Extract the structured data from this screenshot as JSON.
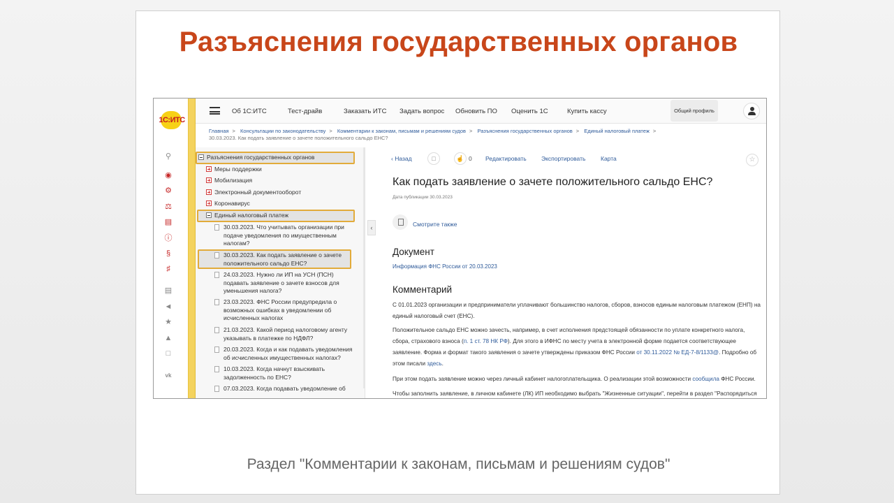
{
  "slide": {
    "title": "Разъяснения государственных органов",
    "caption": "Раздел \"Комментарии к законам, письмам и решениям судов\""
  },
  "app": {
    "logo": "1С:ИТС",
    "nav": [
      "Об 1С:ИТС",
      "Тест-драйв",
      "Заказать ИТС",
      "Задать вопрос",
      "Обновить ПО",
      "Оценить 1С",
      "Купить кассу"
    ],
    "profile_label": "Общий профиль"
  },
  "breadcrumb": {
    "items": [
      "Главная",
      "Консультации по законодательству",
      "Комментарии к законам, письмам и решениям судов",
      "Разъяснения государственных органов",
      "Единый налоговый платеж"
    ],
    "current": "30.03.2023. Как подать заявление о зачете положительного сальдо ЕНС?"
  },
  "tree": {
    "root": "Разъяснения государственных органов",
    "folders": [
      "Меры поддержки",
      "Мобилизация",
      "Электронный документооборот",
      "Коронавирус"
    ],
    "open_folder": "Единый налоговый платеж",
    "docs": [
      "30.03.2023. Что учитывать организации при подаче уведомления по имущественным налогам?",
      "30.03.2023. Как подать заявление о зачете положительного сальдо ЕНС?",
      "24.03.2023. Нужно ли ИП на УСН (ПСН) подавать заявление о зачете взносов для уменьшения налога?",
      "23.03.2023. ФНС России предупредила о возможных ошибках в уведомлении об исчисленных налогах",
      "21.03.2023. Какой период налоговому агенту указывать в платежке по НДФЛ?",
      "20.03.2023. Когда и как подавать уведомления об исчисленных имущественных налогах?",
      "10.03.2023. Когда начнут взыскивать задолженность по ЕНС?",
      "07.03.2023. Когда подавать уведомление об"
    ]
  },
  "content": {
    "toolbar": {
      "back": "Назад",
      "likes": "0",
      "edit": "Редактировать",
      "export": "Экспортировать",
      "map": "Карта"
    },
    "title": "Как подать заявление о зачете положительного сальдо ЕНС?",
    "date": "Дата публикации 30.03.2023",
    "see_also": "Смотрите также",
    "doc_heading": "Документ",
    "doc_link": "Информация ФНС России от 20.03.2023",
    "comment_heading": "Комментарий",
    "p1": "С 01.01.2023 организации и предприниматели уплачивают большинство налогов, сборов, взносов единым налоговым платежом (ЕНП) на единый налоговый счет (ЕНС).",
    "p2_a": "Положительное сальдо ЕНС можно зачесть, например, в счет исполнения предстоящей обязанности по уплате конкретного налога, сбора, страхового взноса (",
    "p2_link1": "п. 1 ст. 78 НК РФ",
    "p2_b": "). Для этого в ИФНС по месту учета в электронной форме подается соответствующее заявление. Форма и формат такого заявления о зачете утверждены приказом ФНС России ",
    "p2_link2": "от 30.11.2022 № ЕД-7-8/1133@",
    "p2_c": ". Подробно об этом писали ",
    "p2_link3": "здесь",
    "p2_d": ".",
    "p3_a": "При этом подать заявление можно через личный кабинет налогоплательщика. О реализации этой возможности ",
    "p3_link": "сообщила",
    "p3_b": " ФНС России.",
    "p4": "Чтобы заполнить заявление, в личном кабинете (ЛК) ИП необходимо выбрать \"Жизненные ситуации\", перейти в раздел \"Распорядиться"
  }
}
